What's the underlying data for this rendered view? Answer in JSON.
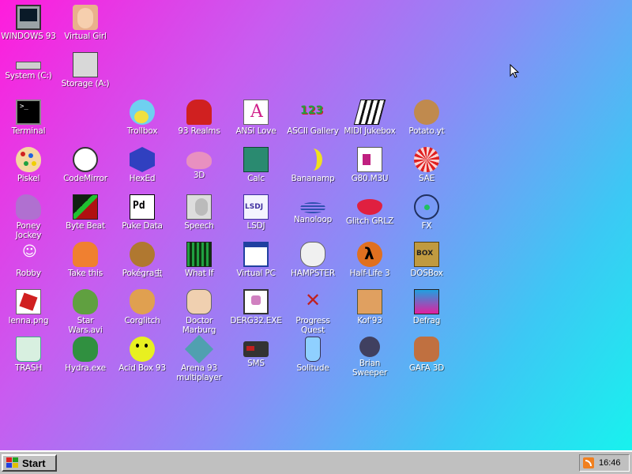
{
  "desktop": {
    "icons": [
      {
        "label": "WINDOWS 93",
        "icon": "monitor-icon"
      },
      {
        "label": "Virtual Girl",
        "icon": "face-icon"
      },
      {
        "label": "System (C:)",
        "icon": "hard-drive-icon"
      },
      {
        "label": "Storage (A:)",
        "icon": "floppy-drive-icon"
      },
      {
        "label": "Terminal",
        "icon": "terminal-icon"
      },
      {
        "label": "Trollbox",
        "icon": "chat-bubble-icon"
      },
      {
        "label": "93 Realms",
        "icon": "knight-icon"
      },
      {
        "label": "ANSI Love",
        "icon": "ansi-letter-icon"
      },
      {
        "label": "ASCII Gallery",
        "icon": "numbers-icon"
      },
      {
        "label": "MIDI Jukebox",
        "icon": "piano-keys-icon"
      },
      {
        "label": "Potato.yt",
        "icon": "potato-icon"
      },
      {
        "label": "Piskel",
        "icon": "paint-palette-icon"
      },
      {
        "label": "CodeMirror",
        "icon": "codemirror-icon"
      },
      {
        "label": "HexEd",
        "icon": "hexagon-icon"
      },
      {
        "label": "3D",
        "icon": "teapot-icon"
      },
      {
        "label": "Calc",
        "icon": "calculator-icon"
      },
      {
        "label": "Bananamp",
        "icon": "banana-icon"
      },
      {
        "label": "G80.M3U",
        "icon": "speaker-file-icon"
      },
      {
        "label": "SAE",
        "icon": "checkered-ball-icon"
      },
      {
        "label": "Poney\nJockey",
        "icon": "pony-icon"
      },
      {
        "label": "Byte Beat",
        "icon": "byte-beat-icon"
      },
      {
        "label": "Puke Data",
        "icon": "pd-icon"
      },
      {
        "label": "Speech",
        "icon": "speech-face-icon"
      },
      {
        "label": "LSDJ",
        "icon": "lsdj-icon"
      },
      {
        "label": "Nanoloop",
        "icon": "wave-icon"
      },
      {
        "label": "Glitch GRLZ",
        "icon": "lips-icon"
      },
      {
        "label": "FX",
        "icon": "atom-icon"
      },
      {
        "label": "Robby",
        "icon": "stick-figure-icon"
      },
      {
        "label": "Take this",
        "icon": "monk-icon"
      },
      {
        "label": "Pokégra虫",
        "icon": "pokemon-icon"
      },
      {
        "label": "What If",
        "icon": "whatif-icon"
      },
      {
        "label": "Virtual PC",
        "icon": "virtual-pc-icon"
      },
      {
        "label": "HAMPSTER",
        "icon": "owl-icon"
      },
      {
        "label": "Half-Life 3",
        "icon": "lambda-icon"
      },
      {
        "label": "DOSBox",
        "icon": "dosbox-icon"
      },
      {
        "label": "lenna.png",
        "icon": "image-file-icon"
      },
      {
        "label": "Star\nWars.avi",
        "icon": "yoda-icon"
      },
      {
        "label": "Corglitch",
        "icon": "corgi-icon"
      },
      {
        "label": "Doctor\nMarburg",
        "icon": "doctor-icon"
      },
      {
        "label": "DERG32.EXE",
        "icon": "derg-icon"
      },
      {
        "label": "Progress\nQuest",
        "icon": "crossed-swords-icon"
      },
      {
        "label": "Kof'93",
        "icon": "fighter-portrait-icon"
      },
      {
        "label": "Defrag",
        "icon": "defrag-icon"
      },
      {
        "label": "TRASH",
        "icon": "recycle-bin-icon"
      },
      {
        "label": "Hydra.exe",
        "icon": "hydra-icon"
      },
      {
        "label": "Acid Box 93",
        "icon": "acid-smiley-icon"
      },
      {
        "label": "Arena 93\nmultiplayer",
        "icon": "cube-icon"
      },
      {
        "label": "SMS",
        "icon": "console-icon"
      },
      {
        "label": "Solitude",
        "icon": "bottle-icon"
      },
      {
        "label": "Brian\nSweeper",
        "icon": "mine-icon"
      },
      {
        "label": "GAFA 3D",
        "icon": "doomguy-icon"
      }
    ]
  },
  "taskbar": {
    "start_label": "Start",
    "clock": "16:46",
    "tray_icon": "rss-icon"
  },
  "colors": {
    "gradient_start": "#ff1cdc",
    "gradient_end": "#18f2ee",
    "taskbar": "#c0c0c0"
  }
}
